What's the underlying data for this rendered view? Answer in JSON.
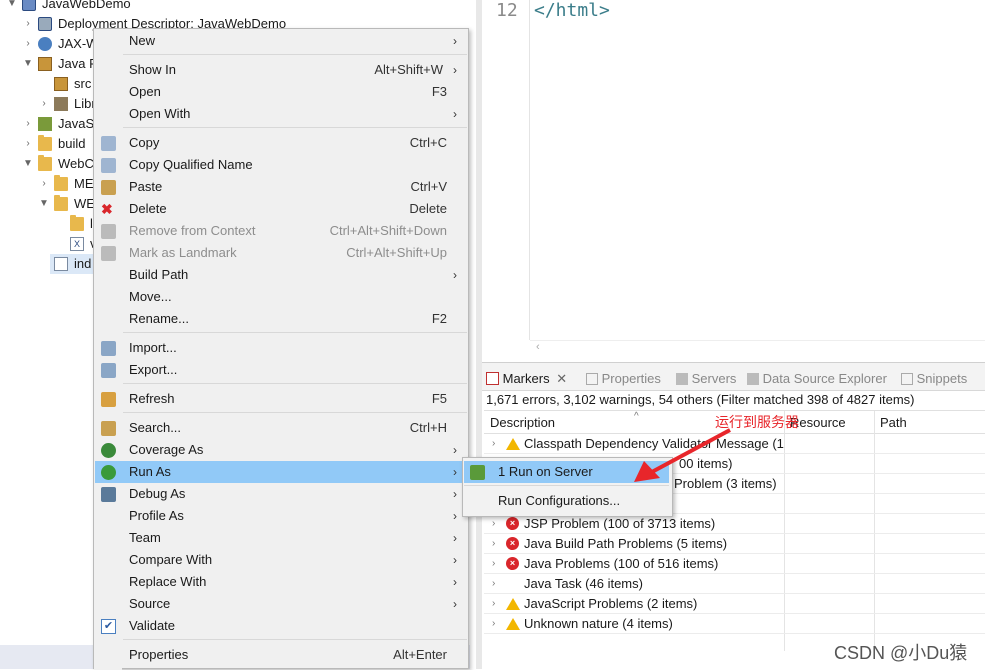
{
  "tree": {
    "items": [
      {
        "label": "JavaWebDemo"
      },
      {
        "label": "Deployment Descriptor: JavaWebDemo"
      },
      {
        "label": "JAX-W"
      },
      {
        "label": "Java R"
      },
      {
        "label": "src"
      },
      {
        "label": "Libr"
      },
      {
        "label": "JavaSc"
      },
      {
        "label": "build"
      },
      {
        "label": "WebC"
      },
      {
        "label": "ME"
      },
      {
        "label": "WE"
      },
      {
        "label": "l"
      },
      {
        "label": "v"
      },
      {
        "label": "ind"
      }
    ]
  },
  "editor": {
    "line_number": "12",
    "code": "</html>"
  },
  "context_menu": {
    "items": [
      {
        "label": "New",
        "accel": ""
      },
      {
        "label": "Show In",
        "accel": "Alt+Shift+W"
      },
      {
        "label": "Open",
        "accel": "F3"
      },
      {
        "label": "Open With",
        "accel": ""
      },
      {
        "label": "Copy",
        "accel": "Ctrl+C"
      },
      {
        "label": "Copy Qualified Name",
        "accel": ""
      },
      {
        "label": "Paste",
        "accel": "Ctrl+V"
      },
      {
        "label": "Delete",
        "accel": "Delete"
      },
      {
        "label": "Remove from Context",
        "accel": "Ctrl+Alt+Shift+Down"
      },
      {
        "label": "Mark as Landmark",
        "accel": "Ctrl+Alt+Shift+Up"
      },
      {
        "label": "Build Path",
        "accel": ""
      },
      {
        "label": "Move...",
        "accel": ""
      },
      {
        "label": "Rename...",
        "accel": "F2"
      },
      {
        "label": "Import...",
        "accel": ""
      },
      {
        "label": "Export...",
        "accel": ""
      },
      {
        "label": "Refresh",
        "accel": "F5"
      },
      {
        "label": "Search...",
        "accel": "Ctrl+H"
      },
      {
        "label": "Coverage As",
        "accel": ""
      },
      {
        "label": "Run As",
        "accel": ""
      },
      {
        "label": "Debug As",
        "accel": ""
      },
      {
        "label": "Profile As",
        "accel": ""
      },
      {
        "label": "Team",
        "accel": ""
      },
      {
        "label": "Compare With",
        "accel": ""
      },
      {
        "label": "Replace With",
        "accel": ""
      },
      {
        "label": "Source",
        "accel": ""
      },
      {
        "label": "Validate",
        "accel": ""
      },
      {
        "label": "Properties",
        "accel": "Alt+Enter"
      }
    ]
  },
  "submenu": {
    "items": [
      {
        "label": "1 Run on Server"
      },
      {
        "label": "Run Configurations..."
      }
    ]
  },
  "bottom_panel": {
    "tabs": [
      {
        "label": "Markers"
      },
      {
        "label": "Properties"
      },
      {
        "label": "Servers"
      },
      {
        "label": "Data Source Explorer"
      },
      {
        "label": "Snippets"
      }
    ],
    "summary": "1,671 errors, 3,102 warnings, 54 others (Filter matched 398 of 4827 items)",
    "columns": [
      "Description",
      "Resource",
      "Path"
    ],
    "rows": [
      {
        "text": "Classpath Dependency Validator Message (1",
        "type": "warning"
      },
      {
        "text": "00 items)",
        "type": "none"
      },
      {
        "text": "Problem (3 items)",
        "type": "none"
      },
      {
        "text": "",
        "type": "none"
      },
      {
        "text": "JSP Problem (100 of 3713 items)",
        "type": "error"
      },
      {
        "text": "Java Build Path Problems (5 items)",
        "type": "error"
      },
      {
        "text": "Java Problems (100 of 516 items)",
        "type": "error"
      },
      {
        "text": "Java Task (46 items)",
        "type": "none"
      },
      {
        "text": "JavaScript Problems (2 items)",
        "type": "warning"
      },
      {
        "text": "Unknown nature (4 items)",
        "type": "warning"
      }
    ]
  },
  "annotation": {
    "text": "运行到服务器"
  },
  "watermark": {
    "text": "CSDN @小Du猿"
  },
  "colors": {
    "highlight": "#91c9f7",
    "arrow": "#e8262b",
    "code": "#3b7d8a"
  }
}
